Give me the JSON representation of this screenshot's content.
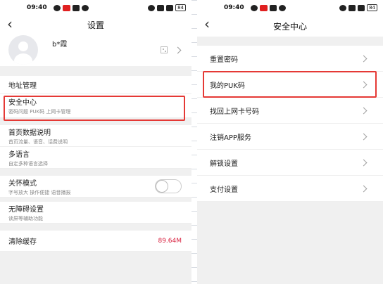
{
  "left_screen": {
    "status": {
      "time": "09:40",
      "battery": "84"
    },
    "nav": {
      "back_glyph": "‹",
      "title": "设置"
    },
    "profile": {
      "name": "b*霞"
    },
    "items": [
      {
        "label": "地址管理",
        "sub": ""
      },
      {
        "label": "安全中心",
        "sub": "密码问题 PUK码 上网卡管理"
      },
      {
        "label": "首页数据说明",
        "sub": "首页流量、语音、话费说明"
      },
      {
        "label": "多语言",
        "sub": "自定多种语言选择"
      },
      {
        "label": "关怀模式",
        "sub": "字号放大 操作便捷 语音播报"
      },
      {
        "label": "无障碍设置",
        "sub": "读屏等辅助功能"
      },
      {
        "label": "清除缓存",
        "value": "89.64M"
      }
    ]
  },
  "right_screen": {
    "status": {
      "time": "09:40",
      "battery": "84"
    },
    "nav": {
      "back_glyph": "‹",
      "title": "安全中心"
    },
    "items": [
      {
        "label": "重置密码"
      },
      {
        "label": "我的PUK码"
      },
      {
        "label": "找回上网卡号码"
      },
      {
        "label": "注销APP服务"
      },
      {
        "label": "解锁设置"
      },
      {
        "label": "支付设置"
      }
    ]
  },
  "colors": {
    "highlight": "#e53935",
    "cache_value": "#d81e3c",
    "page_bg": "#f0f0f0"
  }
}
